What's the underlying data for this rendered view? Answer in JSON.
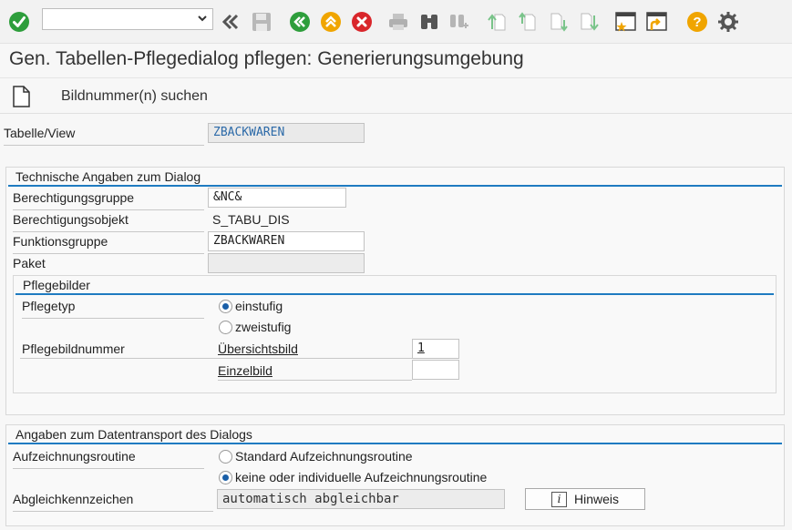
{
  "toolbar": {
    "command_field": {
      "value": "",
      "placeholder": ""
    },
    "icons": [
      "enter-icon",
      "collapse-icon",
      "save-icon",
      "back-icon",
      "exit-icon",
      "cancel-icon",
      "print-icon",
      "find-icon",
      "find-next-icon",
      "first-page-icon",
      "previous-page-icon",
      "next-page-icon",
      "last-page-icon",
      "new-session-icon",
      "shortcut-icon",
      "help-icon",
      "settings-icon"
    ]
  },
  "title": "Gen. Tabellen-Pflegedialog pflegen: Generierungsumgebung",
  "app_toolbar": {
    "search_label": "Bildnummer(n) suchen"
  },
  "table_view": {
    "label": "Tabelle/View",
    "value": "ZBACKWAREN"
  },
  "technical": {
    "title": "Technische Angaben zum Dialog",
    "auth_group": {
      "label": "Berechtigungsgruppe",
      "value": "&NC&"
    },
    "auth_object": {
      "label": "Berechtigungsobjekt",
      "value": "S_TABU_DIS"
    },
    "function_group": {
      "label": "Funktionsgruppe",
      "value": "ZBACKWAREN"
    },
    "package": {
      "label": "Paket",
      "value": ""
    },
    "screens": {
      "title": "Pflegebilder",
      "type_label": "Pflegetyp",
      "option_one_step": "einstufig",
      "option_two_step": "zweistufig",
      "selected": "einstufig",
      "number_label": "Pflegebildnummer",
      "overview_label": "Übersichtsbild",
      "overview_value": "1",
      "single_label": "Einzelbild",
      "single_value": ""
    }
  },
  "transport": {
    "title": "Angaben zum Datentransport des Dialogs",
    "routine_label": "Aufzeichnungsroutine",
    "option_standard": "Standard Aufzeichnungsroutine",
    "option_individual": "keine oder individuelle Aufzeichnungsroutine",
    "selected": "keine oder individuelle Aufzeichnungsroutine",
    "compare_label": "Abgleichkennzeichen",
    "compare_value": "automatisch abgleichbar",
    "hint_button": "Hinweis"
  },
  "colors": {
    "accent": "#1f7bc1",
    "green": "#2e9e3c",
    "red": "#d9262b",
    "orange": "#f0a500"
  }
}
